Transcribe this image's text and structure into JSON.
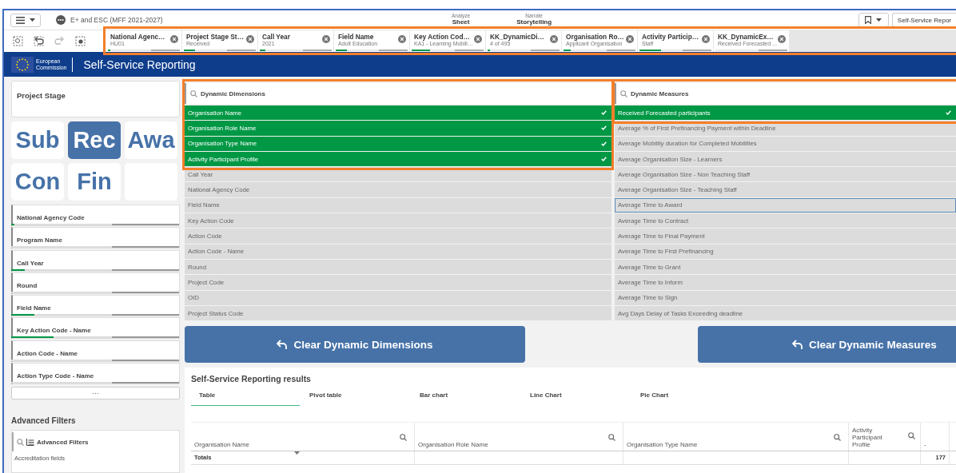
{
  "app_bar": {
    "app_title": "E+ and ESC (MFF 2021-2027)",
    "nav": [
      {
        "label": "Analyze",
        "value": "Sheet"
      },
      {
        "label": "Narrate",
        "value": "Storytelling"
      }
    ],
    "sheet_button": "Self-Service Repor"
  },
  "filter_bar": {
    "highlighted": true,
    "chips": [
      {
        "field": "National Agenc…",
        "value": "HU01",
        "level": 0.03
      },
      {
        "field": "Project Stage St…",
        "value": "Received",
        "level": 0.15
      },
      {
        "field": "Call Year",
        "value": "2021",
        "level": 0.08
      },
      {
        "field": "Field Name",
        "value": "Adult Education",
        "level": 0.15
      },
      {
        "field": "Key Action Cod…",
        "value": "KA1 - Learning Mobili…",
        "level": 0.25
      },
      {
        "field": "KK_DynamicDi…",
        "value": "4 of 495",
        "level": 0.03
      },
      {
        "field": "Organisation Ro…",
        "value": "Applicant Organisation",
        "level": 0.1
      },
      {
        "field": "Activity Particip…",
        "value": "Staff",
        "level": 0.3
      },
      {
        "field": "KK_DynamicEx…",
        "value": "Received Forecasted …",
        "level": 0
      }
    ]
  },
  "banner": {
    "logo_lines": [
      "European",
      "Commission"
    ],
    "title": "Self-Service Reporting"
  },
  "project_stage": {
    "title": "Project Stage",
    "tiles": [
      {
        "label": "Sub",
        "selected": false
      },
      {
        "label": "Rec",
        "selected": true
      },
      {
        "label": "Awa",
        "selected": false
      },
      {
        "label": "Con",
        "selected": false
      },
      {
        "label": "Fin",
        "selected": false
      }
    ]
  },
  "filters": [
    {
      "label": "National Agency Code",
      "level": 0.02
    },
    {
      "label": "Program Name",
      "level": 0
    },
    {
      "label": "Call Year",
      "level": 0.08
    },
    {
      "label": "Round",
      "level": 0
    },
    {
      "label": "Field Name",
      "level": 0.14
    },
    {
      "label": "Key Action Code - Name",
      "level": 0.25
    },
    {
      "label": "Action Code - Name",
      "level": 0
    },
    {
      "label": "Action Type Code - Name",
      "level": 0
    }
  ],
  "more_button": "···",
  "advanced_filters": {
    "heading": "Advanced Filters",
    "search_label": "Advanced Filters",
    "items": [
      "Accreditation fields"
    ]
  },
  "dimensions": {
    "highlighted": true,
    "title": "Dynamic Dimensions",
    "clear_button": "Clear Dynamic Dimensions",
    "items": [
      {
        "label": "Organisation Name",
        "selected": true,
        "focused": false
      },
      {
        "label": "Organisation Role Name",
        "selected": true,
        "focused": false
      },
      {
        "label": "Organisation Type Name",
        "selected": true,
        "focused": false
      },
      {
        "label": "Activity Participant Profile",
        "selected": true,
        "focused": false
      },
      {
        "label": "Call Year",
        "selected": false,
        "focused": false
      },
      {
        "label": "National Agency Code",
        "selected": false,
        "focused": false
      },
      {
        "label": "Field Name",
        "selected": false,
        "focused": false
      },
      {
        "label": "Key Action Code",
        "selected": false,
        "focused": false
      },
      {
        "label": "Action Code",
        "selected": false,
        "focused": false
      },
      {
        "label": "Action Code - Name",
        "selected": false,
        "focused": false
      },
      {
        "label": "Round",
        "selected": false,
        "focused": false
      },
      {
        "label": "Project Code",
        "selected": false,
        "focused": false
      },
      {
        "label": "OID",
        "selected": false,
        "focused": false
      },
      {
        "label": "Project Status Code",
        "selected": false,
        "focused": false
      }
    ]
  },
  "measures": {
    "highlighted": true,
    "title": "Dynamic Measures",
    "clear_button": "Clear Dynamic Measures",
    "items": [
      {
        "label": "Received Forecasted participants",
        "selected": true,
        "focused": false
      },
      {
        "label": "Average % of First Prefinancing Payment within Deadline",
        "selected": false,
        "focused": false
      },
      {
        "label": "Average Mobility duration for Completed Mobilities",
        "selected": false,
        "focused": false
      },
      {
        "label": "Average Organisation Size - Learners",
        "selected": false,
        "focused": false
      },
      {
        "label": "Average Organisation Size - Non Teaching Staff",
        "selected": false,
        "focused": false
      },
      {
        "label": "Average Organisation Size - Teaching Staff",
        "selected": false,
        "focused": false
      },
      {
        "label": "Average Time to Award",
        "selected": false,
        "focused": true
      },
      {
        "label": "Average Time to Contract",
        "selected": false,
        "focused": false
      },
      {
        "label": "Average Time to Final Payment",
        "selected": false,
        "focused": false
      },
      {
        "label": "Average Time to First Prefinancing",
        "selected": false,
        "focused": false
      },
      {
        "label": "Average Time to Grant",
        "selected": false,
        "focused": false
      },
      {
        "label": "Average Time to Inform",
        "selected": false,
        "focused": false
      },
      {
        "label": "Average Time to Sign",
        "selected": false,
        "focused": false
      },
      {
        "label": "Avg Days Delay of Tasks Exceeding deadline",
        "selected": false,
        "focused": false
      }
    ]
  },
  "results": {
    "title": "Self-Service Reporting results",
    "tabs": [
      {
        "label": "Table",
        "selected": true
      },
      {
        "label": "Pivot table",
        "selected": false
      },
      {
        "label": "Bar chart",
        "selected": false
      },
      {
        "label": "Line Chart",
        "selected": false
      },
      {
        "label": "Pie Chart",
        "selected": false
      }
    ],
    "table": {
      "columns": [
        {
          "label": "Organisation Name",
          "searchable": true,
          "sorted": true
        },
        {
          "label": "Organisation Role Name",
          "searchable": true,
          "sorted": false
        },
        {
          "label": "Organisation Type Name",
          "searchable": true,
          "sorted": false
        },
        {
          "label": "Activity Participant Profile",
          "searchable": true,
          "sorted": false
        },
        {
          "label": "-",
          "searchable": false,
          "sorted": false
        }
      ],
      "totals": {
        "label": "Totals",
        "value": "177"
      }
    }
  }
}
